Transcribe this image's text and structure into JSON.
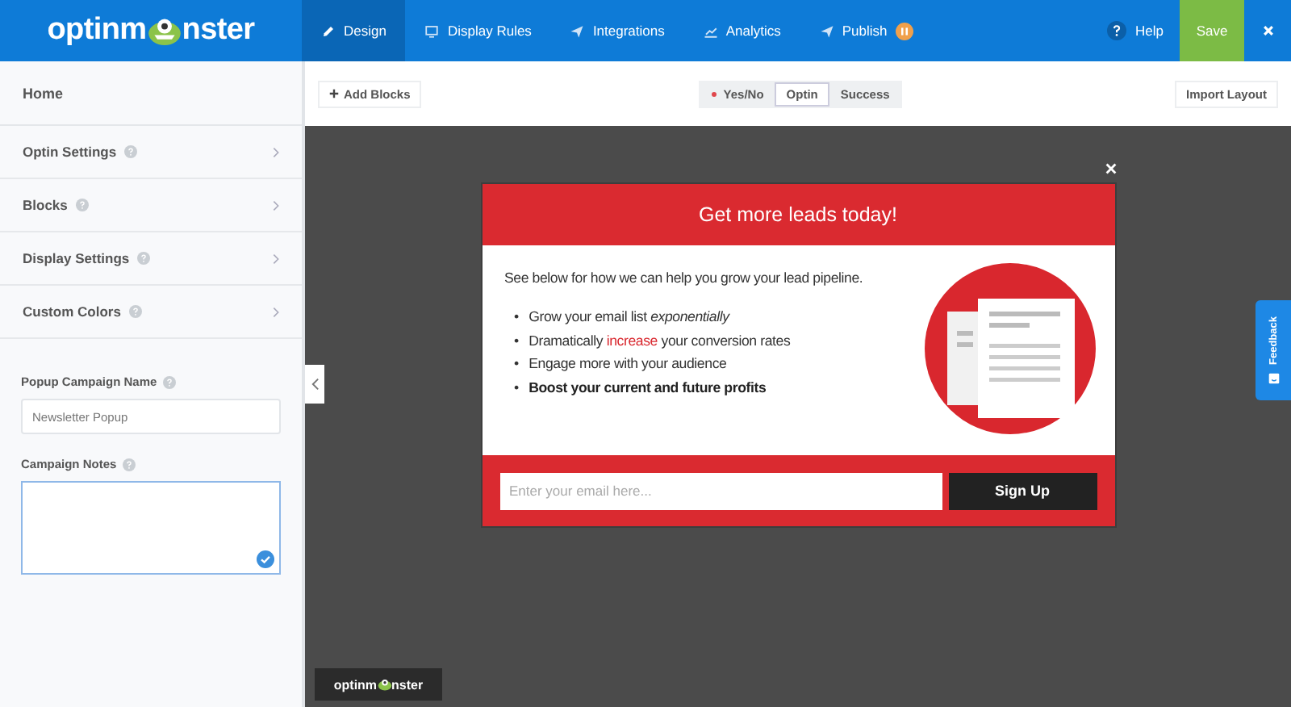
{
  "logo": {
    "before": "optinm",
    "after": "nster"
  },
  "nav": [
    {
      "label": "Design",
      "selected": true,
      "paused": false
    },
    {
      "label": "Display Rules",
      "selected": false,
      "paused": false
    },
    {
      "label": "Integrations",
      "selected": false,
      "paused": false
    },
    {
      "label": "Analytics",
      "selected": false,
      "paused": false
    },
    {
      "label": "Publish",
      "selected": false,
      "paused": true
    }
  ],
  "help": "Help",
  "save": "Save",
  "sidebar": {
    "title": "Home",
    "sections": [
      "Optin Settings",
      "Blocks",
      "Display Settings",
      "Custom Colors"
    ],
    "fields": [
      {
        "label": "Popup Campaign Name",
        "kind": "input",
        "value": "Newsletter Popup"
      },
      {
        "label": "Campaign Notes",
        "kind": "textarea",
        "valid": true
      }
    ]
  },
  "toolbar": {
    "add": "Add Blocks",
    "import": "Import Layout",
    "views": [
      {
        "label": "Yes/No",
        "selected": false,
        "dot": true
      },
      {
        "label": "Optin",
        "selected": true,
        "dot": false
      },
      {
        "label": "Success",
        "selected": false,
        "dot": false
      }
    ]
  },
  "popup": {
    "title": "Get more leads today!",
    "intro": "See below for how we can help you grow your lead pipeline.",
    "bullets": [
      {
        "marker": "•",
        "bold": false,
        "parts": [
          {
            "text": "Grow your email list ",
            "kind": "plain"
          },
          {
            "text": "exponentially",
            "kind": "italic"
          }
        ]
      },
      {
        "marker": "•",
        "bold": false,
        "parts": [
          {
            "text": "Dramatically ",
            "kind": "plain"
          },
          {
            "text": "increase",
            "kind": "accent"
          },
          {
            "text": " your conversion rates",
            "kind": "plain"
          }
        ]
      },
      {
        "marker": "•",
        "bold": false,
        "parts": [
          {
            "text": "Engage more with your audience",
            "kind": "plain"
          }
        ]
      },
      {
        "marker": "•",
        "bold": true,
        "parts": [
          {
            "text": "Boost your current and future profits",
            "kind": "plain"
          }
        ]
      }
    ],
    "email_placeholder": "Enter your email here...",
    "button": "Sign Up"
  },
  "feedback": "Feedback",
  "footer_logo": {
    "before": "optinm",
    "after": "nster"
  }
}
